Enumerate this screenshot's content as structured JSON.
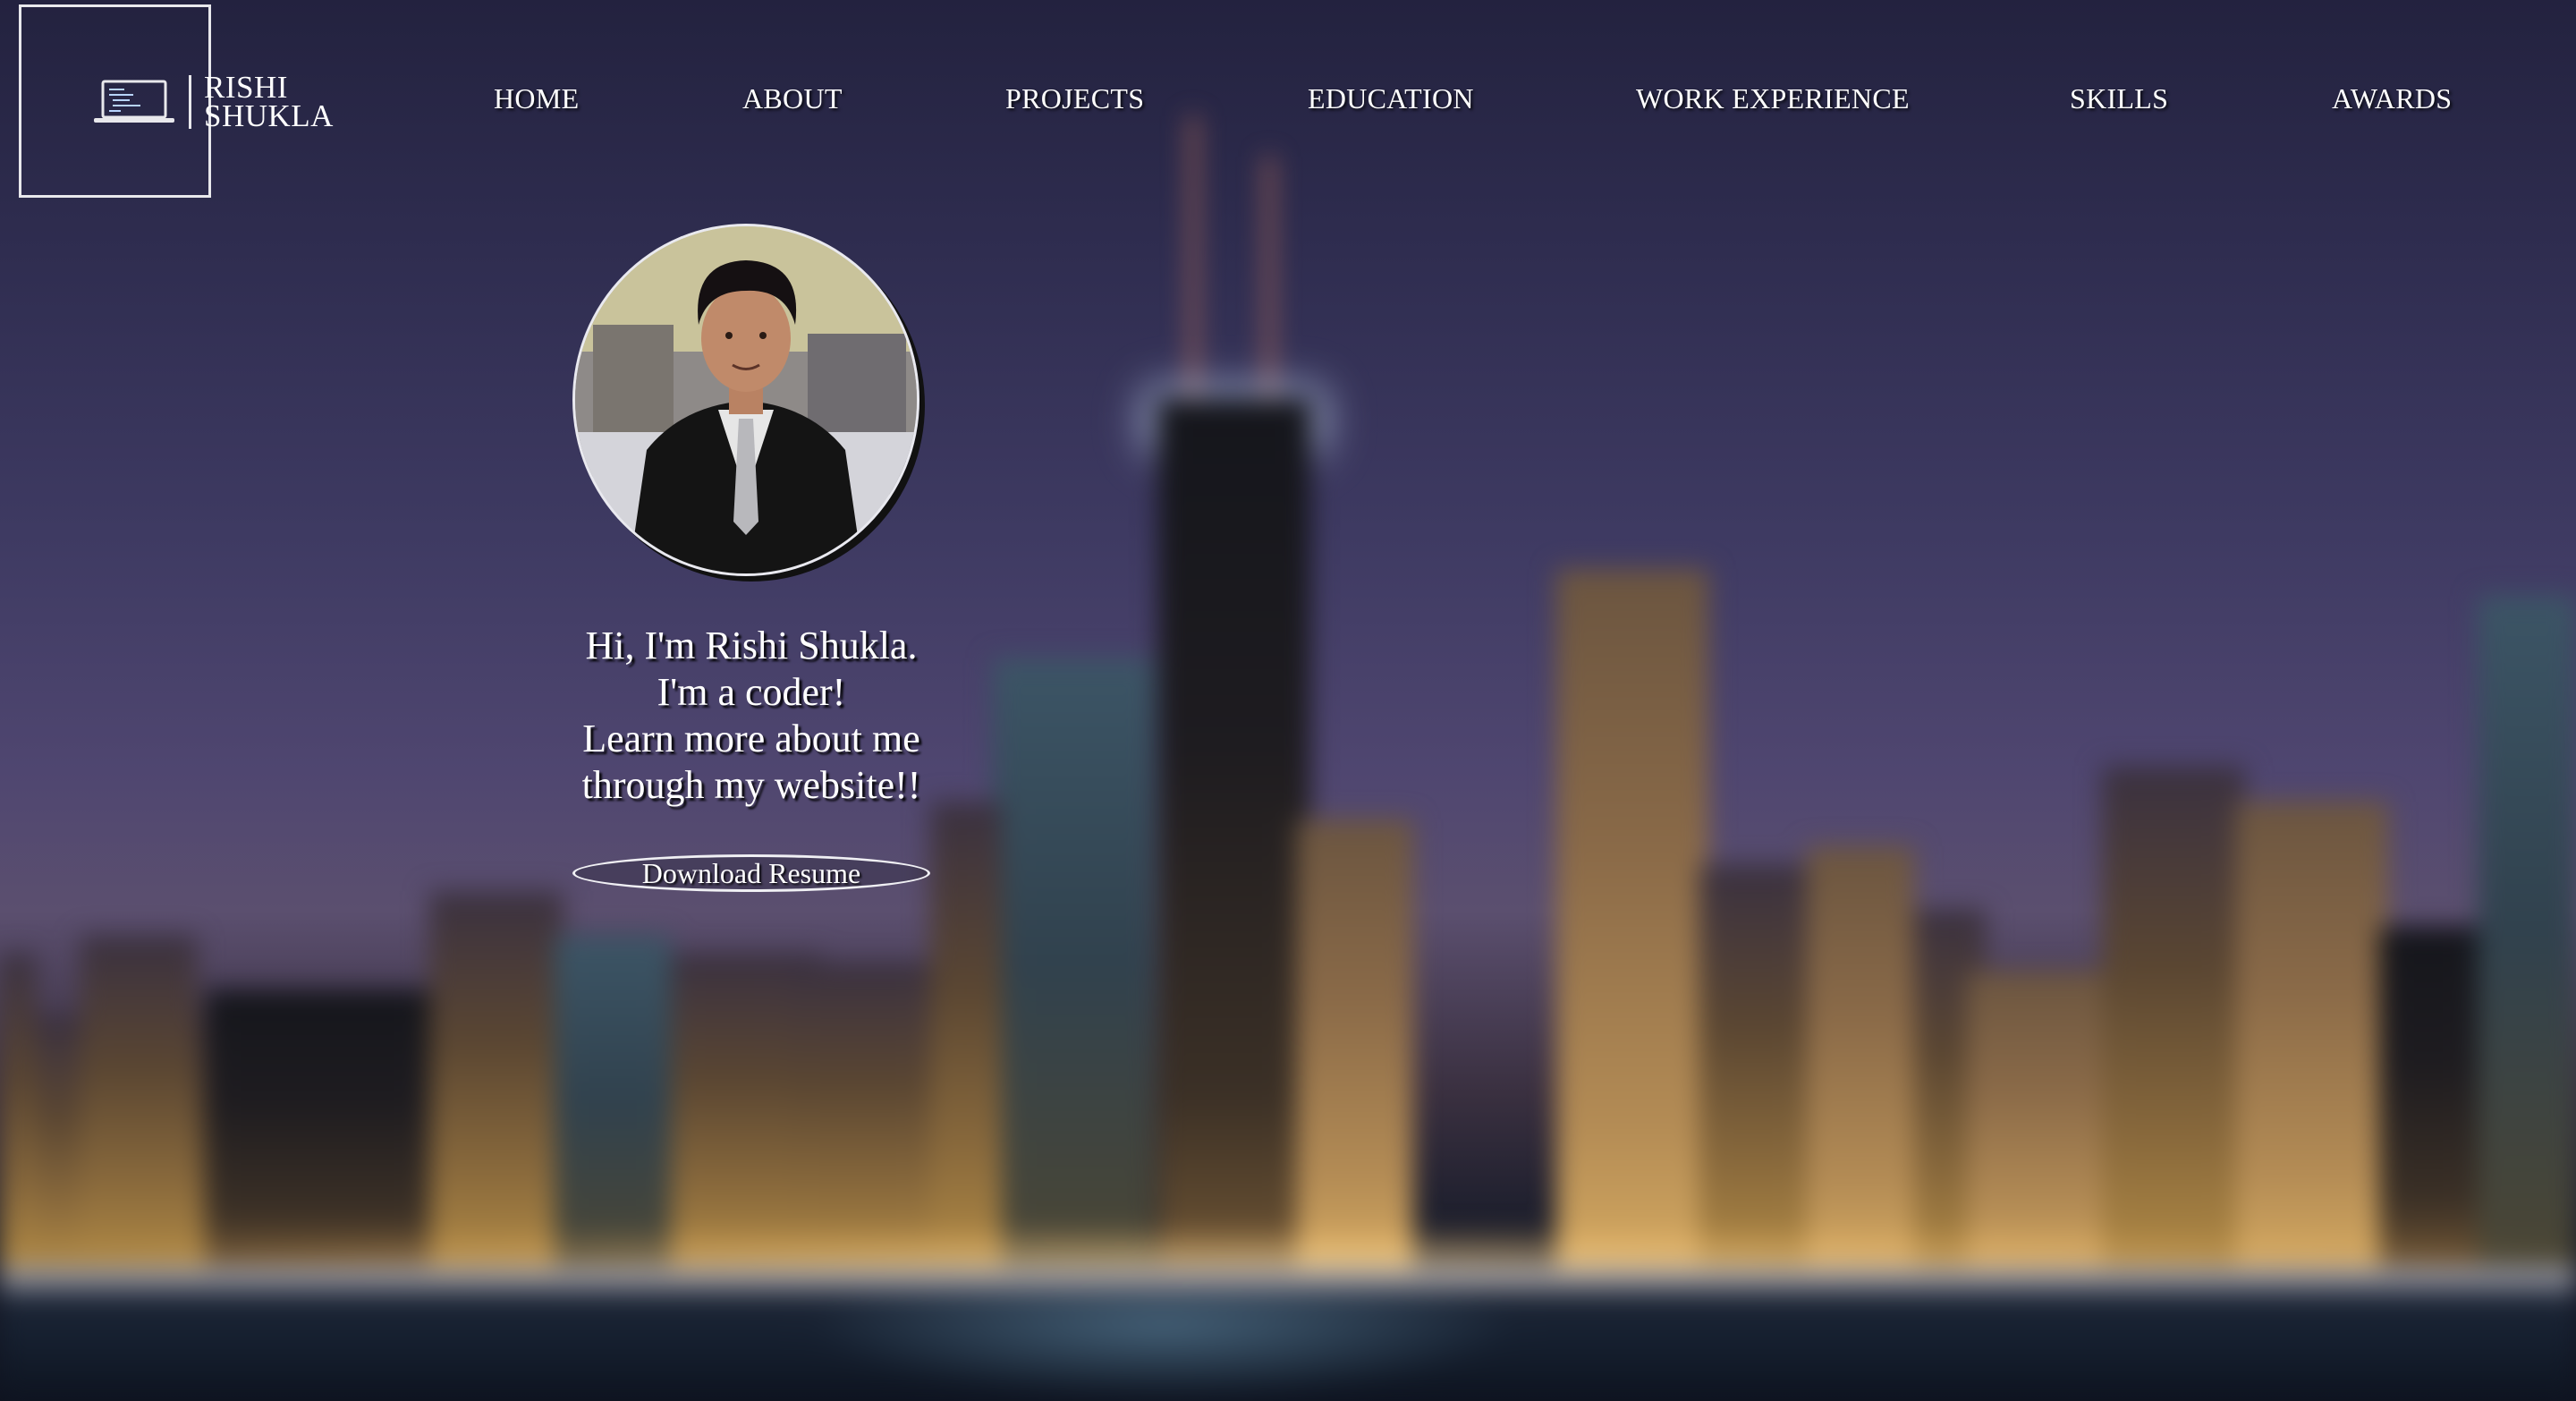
{
  "logo": {
    "line1": "RISHI",
    "line2": "SHUKLA",
    "icon": "laptop-code-icon"
  },
  "nav": {
    "items": [
      {
        "label": "HOME"
      },
      {
        "label": "ABOUT"
      },
      {
        "label": "PROJECTS"
      },
      {
        "label": "EDUCATION"
      },
      {
        "label": "WORK EXPERIENCE"
      },
      {
        "label": "SKILLS"
      },
      {
        "label": "AWARDS"
      }
    ]
  },
  "hero": {
    "avatar_alt": "profile-photo",
    "intro_lines": [
      "Hi, I'm Rishi Shukla.",
      "I'm a coder!",
      "Learn more about me",
      "through my website!!"
    ],
    "resume_button": "Download Resume"
  },
  "colors": {
    "text": "#ffffff",
    "outline": "#e8e8ec",
    "sky_top": "#23223f",
    "sky_mid": "#4f4670"
  }
}
